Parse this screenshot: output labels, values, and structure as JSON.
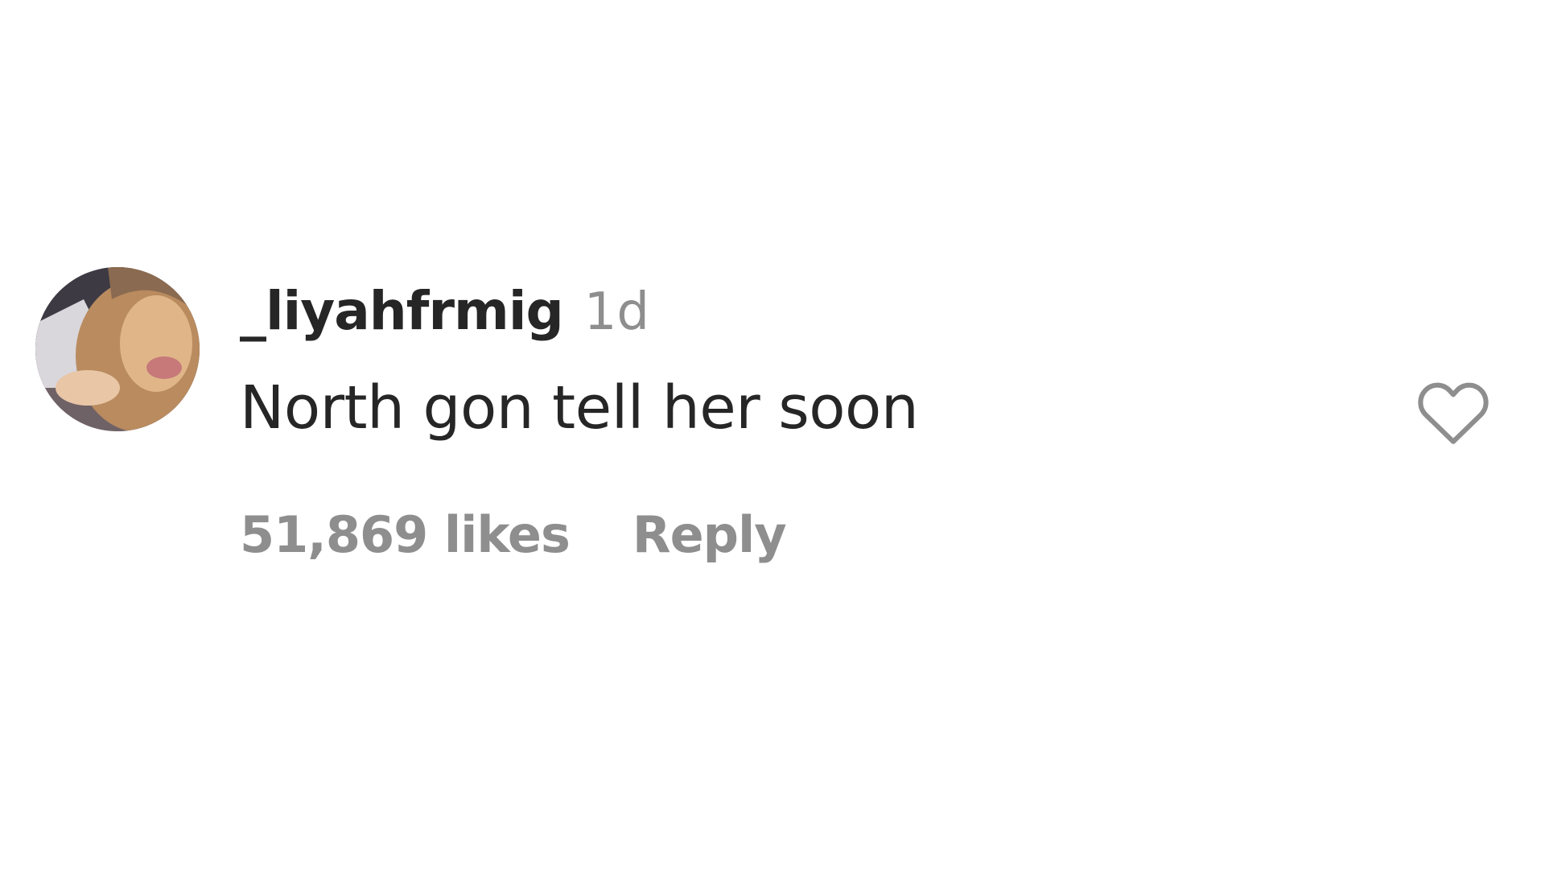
{
  "comment": {
    "username": "_liyahfrmig",
    "timestamp": "1d",
    "text": "North gon tell her soon",
    "likes": "51,869 likes",
    "reply_label": "Reply",
    "like_icon": "heart-outline-icon"
  },
  "colors": {
    "text_primary": "#262626",
    "text_secondary": "#8e8e8e",
    "background": "#ffffff"
  }
}
